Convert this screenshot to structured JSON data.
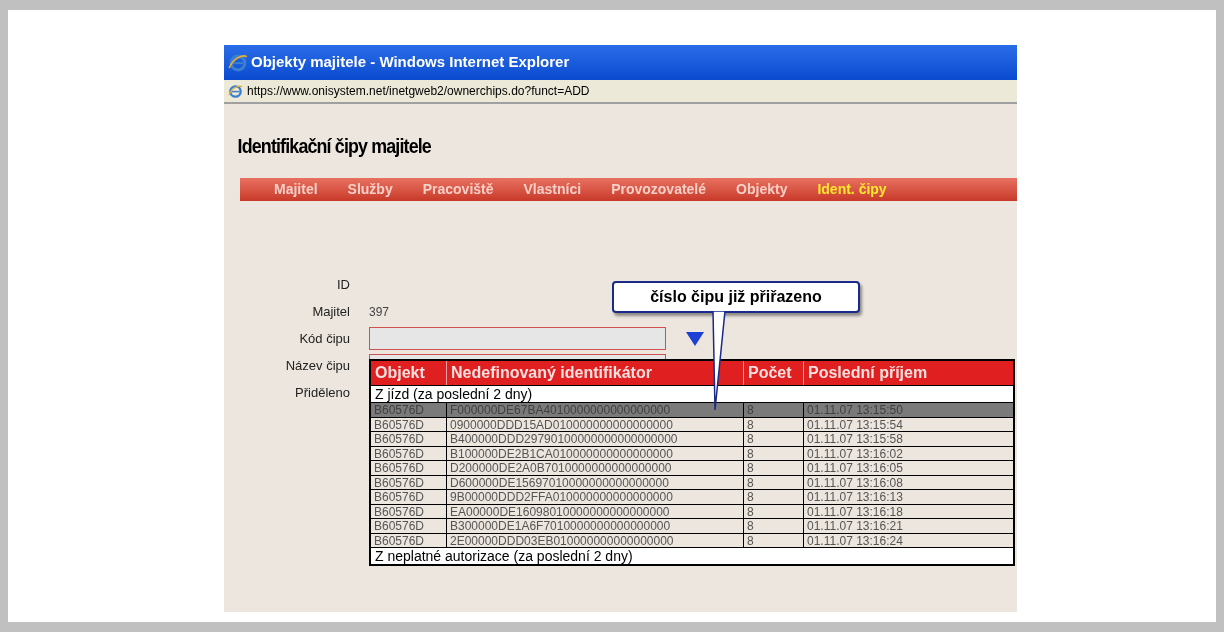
{
  "window": {
    "title": "Objekty majitele - Windows Internet Explorer",
    "address": "https://www.onisystem.net/inetgweb2/ownerchips.do?funct=ADD"
  },
  "page_title": "Identifikační čipy majitele",
  "nav": [
    {
      "label": "Majitel",
      "selected": false
    },
    {
      "label": "Služby",
      "selected": false
    },
    {
      "label": "Pracoviště",
      "selected": false
    },
    {
      "label": "Vlastníci",
      "selected": false
    },
    {
      "label": "Provozovatelé",
      "selected": false
    },
    {
      "label": "Objekty",
      "selected": false
    },
    {
      "label": "Ident. čipy",
      "selected": true
    }
  ],
  "form": [
    {
      "label": "ID",
      "kind": "text"
    },
    {
      "label": "Majitel",
      "kind": "text",
      "value": "397"
    },
    {
      "label": "Kód čipu",
      "kind": "input"
    },
    {
      "label": "Název čipu",
      "kind": "input"
    },
    {
      "label": "Přiděleno",
      "kind": "text"
    }
  ],
  "callout": "číslo čipu již přiřazeno",
  "table": {
    "columns": [
      "Objekt",
      "Nedefinovaný identifikátor",
      "Počet",
      "Poslední příjem"
    ],
    "rows": [
      {
        "kind": "group",
        "label": "Z jízd (za poslední 2 dny)"
      },
      {
        "kind": "data",
        "selected": true,
        "cells": [
          "B60576D",
          "F000000DE67BA4010000000000000000",
          "8",
          "01.11.07 13:15:50"
        ]
      },
      {
        "kind": "data",
        "selected": false,
        "cells": [
          "B60576D",
          "0900000DDD15AD010000000000000000",
          "8",
          "01.11.07 13:15:54"
        ]
      },
      {
        "kind": "data",
        "selected": false,
        "cells": [
          "B60576D",
          "B400000DDD29790100000000000000000",
          "8",
          "01.11.07 13:15:58"
        ]
      },
      {
        "kind": "data",
        "selected": false,
        "cells": [
          "B60576D",
          "B100000DE2B1CA010000000000000000",
          "8",
          "01.11.07 13:16:02"
        ]
      },
      {
        "kind": "data",
        "selected": false,
        "cells": [
          "B60576D",
          "D200000DE2A0B7010000000000000000",
          "8",
          "01.11.07 13:16:05"
        ]
      },
      {
        "kind": "data",
        "selected": false,
        "cells": [
          "B60576D",
          "D600000DE15697010000000000000000",
          "8",
          "01.11.07 13:16:08"
        ]
      },
      {
        "kind": "data",
        "selected": false,
        "cells": [
          "B60576D",
          "9B00000DDD2FFA010000000000000000",
          "8",
          "01.11.07 13:16:13"
        ]
      },
      {
        "kind": "data",
        "selected": false,
        "cells": [
          "B60576D",
          "EA00000DE16098010000000000000000",
          "8",
          "01.11.07 13:16:18"
        ]
      },
      {
        "kind": "data",
        "selected": false,
        "cells": [
          "B60576D",
          "B300000DE1A6F7010000000000000000",
          "8",
          "01.11.07 13:16:21"
        ]
      },
      {
        "kind": "data",
        "selected": false,
        "cells": [
          "B60576D",
          "2E00000DDD03EB010000000000000000",
          "8",
          "01.11.07 13:16:24"
        ]
      },
      {
        "kind": "group",
        "label": "Z neplatné autorizace (za poslední 2 dny)"
      }
    ]
  }
}
